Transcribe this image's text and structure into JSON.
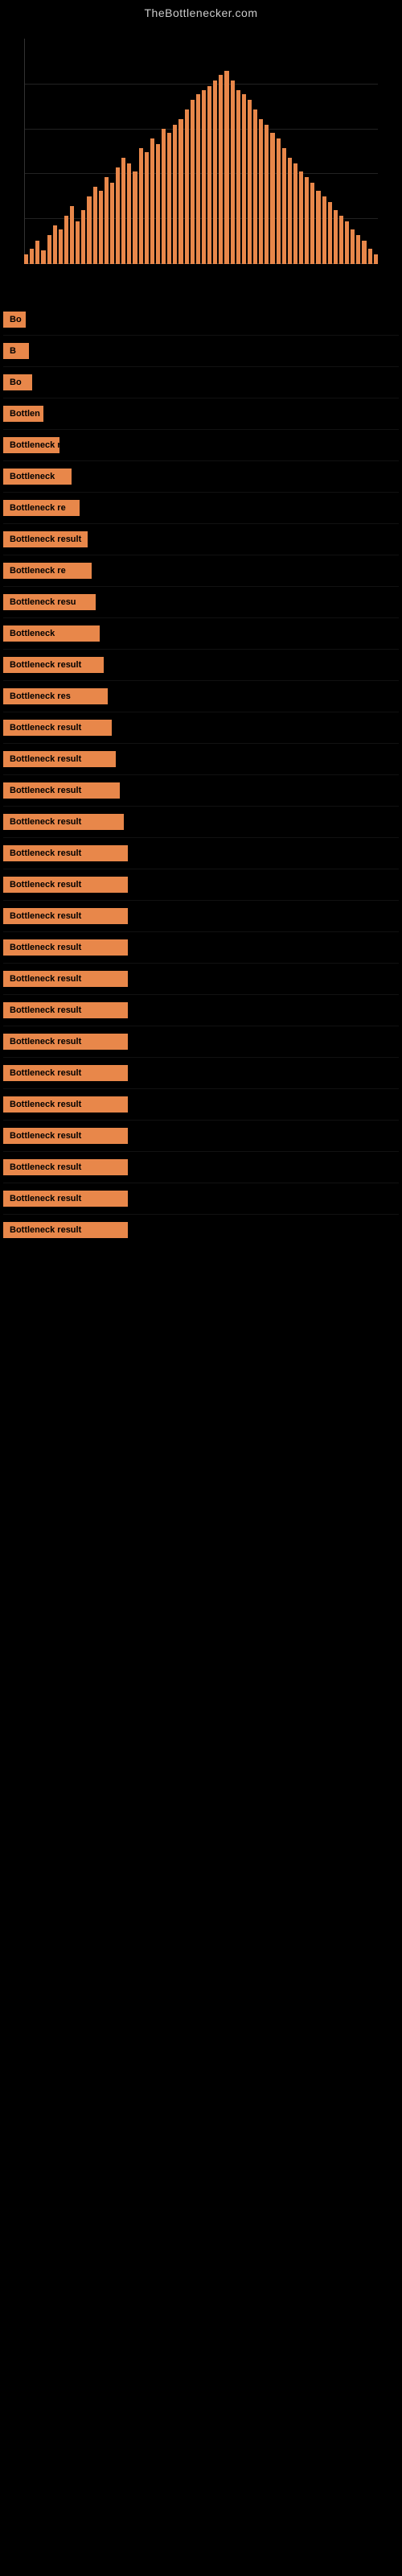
{
  "site": {
    "title": "TheBottlenecker.com"
  },
  "chart": {
    "bars": [
      5,
      8,
      12,
      7,
      15,
      20,
      18,
      25,
      30,
      22,
      28,
      35,
      40,
      38,
      45,
      42,
      50,
      55,
      52,
      48,
      60,
      58,
      65,
      62,
      70,
      68,
      72,
      75,
      80,
      85,
      88,
      90,
      92,
      95,
      98,
      100,
      95,
      90,
      88,
      85,
      80,
      75,
      72,
      68,
      65,
      60,
      55,
      52,
      48,
      45,
      42,
      38,
      35,
      32,
      28,
      25,
      22,
      18,
      15,
      12,
      8,
      5
    ]
  },
  "results": [
    {
      "label": "Bo",
      "width_class": "w1"
    },
    {
      "label": "B",
      "width_class": "w2"
    },
    {
      "label": "Bo",
      "width_class": "w3"
    },
    {
      "label": "Bottlen",
      "width_class": "w4"
    },
    {
      "label": "Bottleneck r",
      "width_class": "w5"
    },
    {
      "label": "Bottleneck",
      "width_class": "w6"
    },
    {
      "label": "Bottleneck re",
      "width_class": "w7"
    },
    {
      "label": "Bottleneck result",
      "width_class": "w8"
    },
    {
      "label": "Bottleneck re",
      "width_class": "w9"
    },
    {
      "label": "Bottleneck resu",
      "width_class": "w10"
    },
    {
      "label": "Bottleneck",
      "width_class": "w11"
    },
    {
      "label": "Bottleneck result",
      "width_class": "w12"
    },
    {
      "label": "Bottleneck res",
      "width_class": "w13"
    },
    {
      "label": "Bottleneck result",
      "width_class": "w14"
    },
    {
      "label": "Bottleneck result",
      "width_class": "w15"
    },
    {
      "label": "Bottleneck result",
      "width_class": "w16"
    },
    {
      "label": "Bottleneck result",
      "width_class": "w17"
    },
    {
      "label": "Bottleneck result",
      "width_class": "w18"
    },
    {
      "label": "Bottleneck result",
      "width_class": "w18"
    },
    {
      "label": "Bottleneck result",
      "width_class": "w18"
    },
    {
      "label": "Bottleneck result",
      "width_class": "w18"
    },
    {
      "label": "Bottleneck result",
      "width_class": "w18"
    },
    {
      "label": "Bottleneck result",
      "width_class": "w18"
    },
    {
      "label": "Bottleneck result",
      "width_class": "w18"
    },
    {
      "label": "Bottleneck result",
      "width_class": "w18"
    },
    {
      "label": "Bottleneck result",
      "width_class": "w18"
    },
    {
      "label": "Bottleneck result",
      "width_class": "w18"
    },
    {
      "label": "Bottleneck result",
      "width_class": "w18"
    },
    {
      "label": "Bottleneck result",
      "width_class": "w18"
    },
    {
      "label": "Bottleneck result",
      "width_class": "w18"
    }
  ]
}
